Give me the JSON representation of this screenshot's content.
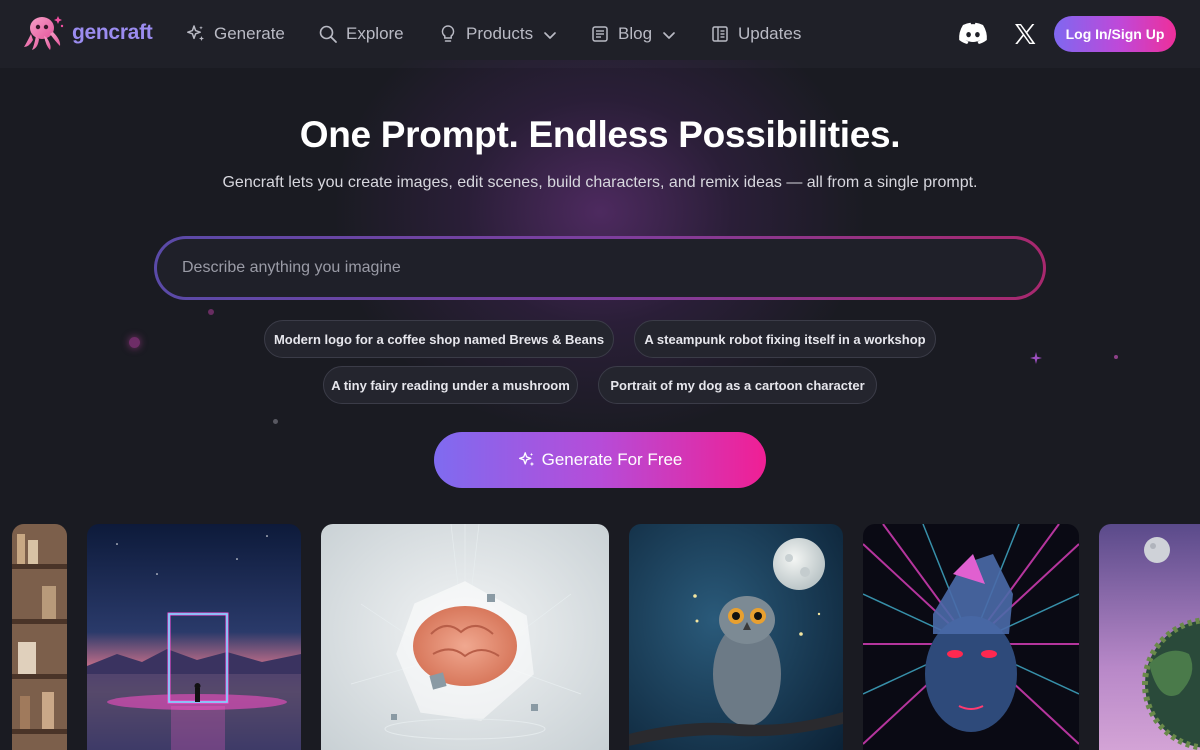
{
  "brand": {
    "name": "gencraft"
  },
  "nav": {
    "items": [
      {
        "label": "Generate",
        "icon": "sparkles-icon"
      },
      {
        "label": "Explore",
        "icon": "search-icon"
      },
      {
        "label": "Products",
        "icon": "lightbulb-icon",
        "dropdown": true
      },
      {
        "label": "Blog",
        "icon": "blog-icon",
        "dropdown": true
      },
      {
        "label": "Updates",
        "icon": "updates-icon"
      }
    ],
    "social": [
      "discord-icon",
      "x-icon"
    ],
    "login_label": "Log In/Sign Up"
  },
  "hero": {
    "title": "One Prompt. Endless Possibilities.",
    "subtitle": "Gencraft lets you create images, edit scenes, build characters, and remix ideas — all from a single prompt."
  },
  "prompt": {
    "placeholder": "Describe anything you imagine"
  },
  "suggestions": [
    "Modern logo for a coffee shop named Brews & Beans",
    "A steampunk robot fixing itself in a workshop",
    "A tiny fairy reading under a mushroom",
    "Portrait of my dog as a cartoon character"
  ],
  "cta": {
    "label": "Generate For Free",
    "icon": "sparkles-icon"
  },
  "gallery": [
    "bookshelf-image",
    "neon-portal-image",
    "crystal-brain-image",
    "owl-moon-image",
    "cyberpunk-face-image",
    "planet-image"
  ],
  "colors": {
    "accent_start": "#7f6bf0",
    "accent_end": "#f01f94",
    "background": "#1a1b22"
  }
}
